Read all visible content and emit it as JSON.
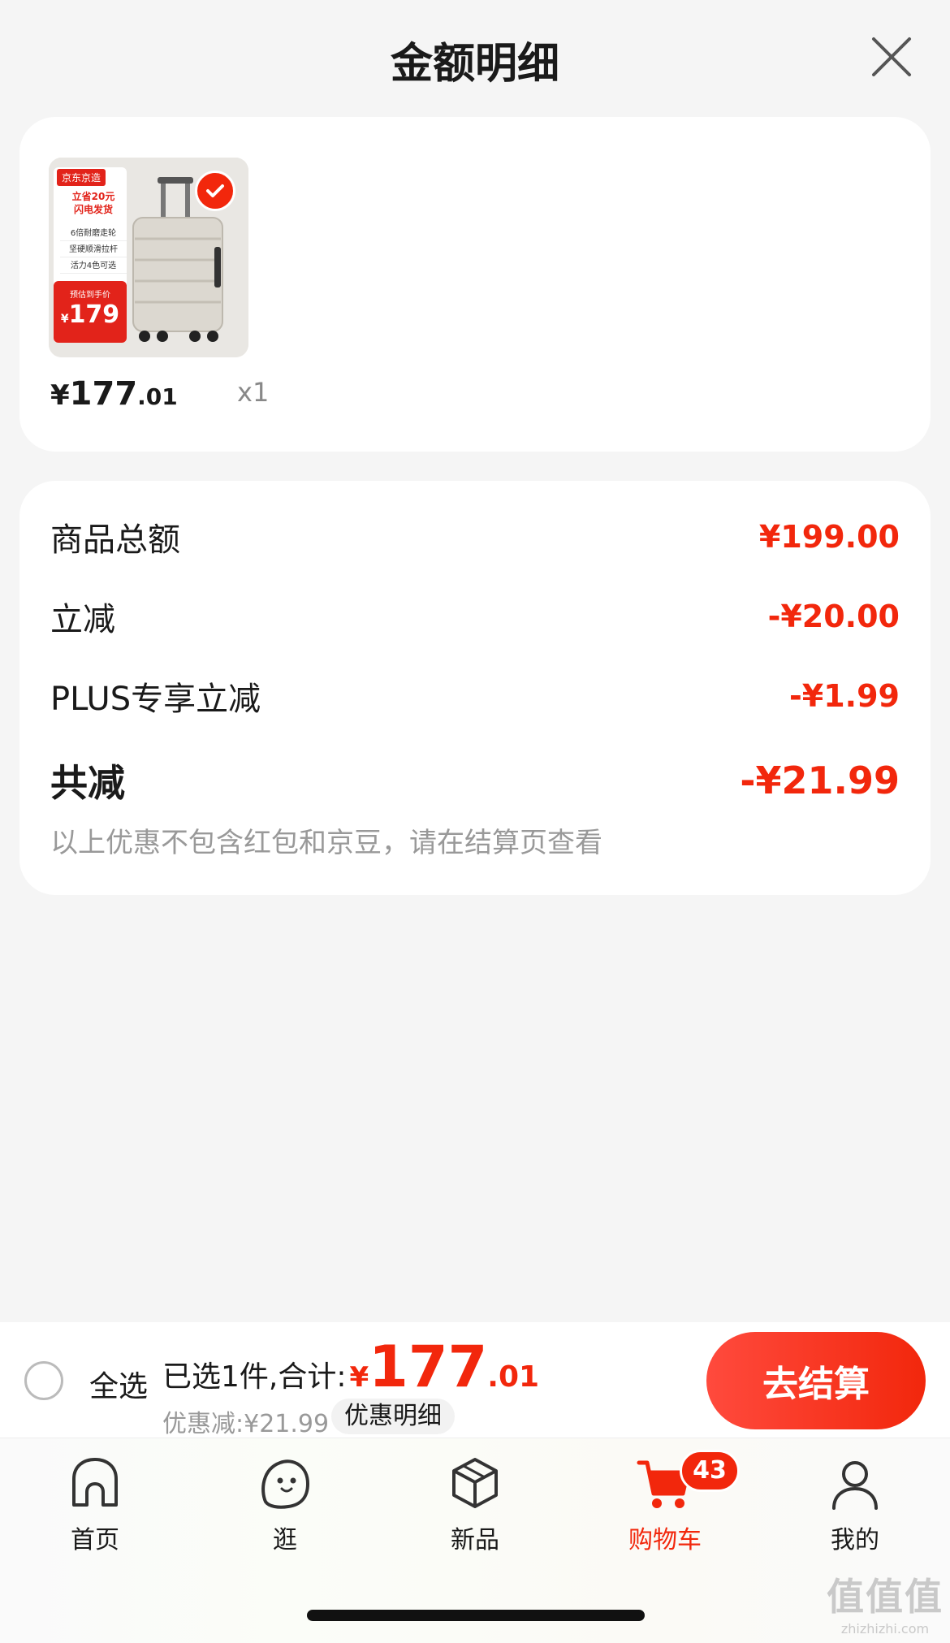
{
  "sheet": {
    "title": "金额明细",
    "close_icon": "close-icon"
  },
  "product": {
    "thumb": {
      "brand_tag": "京东京造",
      "promo_headline": "立省20元",
      "promo_headline2": "闪电发货",
      "features": [
        "6倍耐磨走轮",
        "坚硬顺滑拉杆",
        "活力4色可选"
      ],
      "price_label": "预估到手价",
      "price_symbol": "¥",
      "price": "179",
      "selected": true
    },
    "price_symbol": "¥",
    "price_int": "177",
    "price_dec": ".01",
    "quantity": "x1"
  },
  "summary": {
    "rows": [
      {
        "label": "商品总额",
        "value": "¥199.00"
      },
      {
        "label": "立减",
        "value": "-¥20.00"
      },
      {
        "label": "PLUS专享立减",
        "value": "-¥1.99"
      }
    ],
    "total": {
      "label": "共减",
      "value": "-¥21.99"
    },
    "note": "以上优惠不包含红包和京豆，请在结算页查看"
  },
  "checkout": {
    "select_all": "全选",
    "selected_text": "已选1件,合计:",
    "total_symbol": "¥",
    "total_int": "177",
    "total_dec": ".01",
    "discount_text": "优惠减:¥21.99",
    "discount_detail": "优惠明细",
    "checkout_button": "去结算"
  },
  "tabs": [
    {
      "label": "首页",
      "icon": "home-icon",
      "active": false
    },
    {
      "label": "逛",
      "icon": "browse-face-icon",
      "active": false
    },
    {
      "label": "新品",
      "icon": "new-product-box-icon",
      "active": false
    },
    {
      "label": "购物车",
      "icon": "cart-icon",
      "active": true,
      "badge": "43"
    },
    {
      "label": "我的",
      "icon": "profile-icon",
      "active": false
    }
  ],
  "watermark": {
    "main": "值值值",
    "sub": "zhizhizhi.com"
  },
  "colors": {
    "accent": "#f2270c",
    "background": "#f5f5f5",
    "muted": "#999999"
  }
}
